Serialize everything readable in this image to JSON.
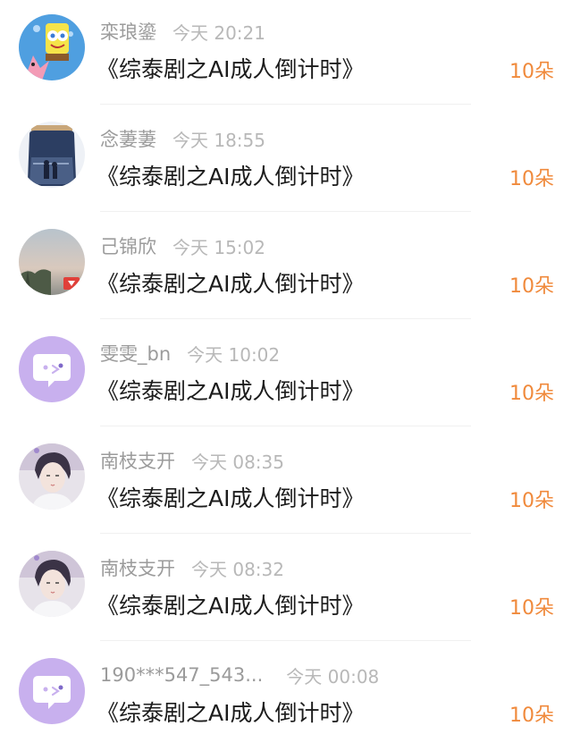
{
  "colors": {
    "accent_amount": "#f08a3c",
    "username": "#9b9b9b",
    "time": "#b8b8b8",
    "title": "#1c1c1c",
    "default_avatar_bg": "#c8b0ee"
  },
  "rows": [
    {
      "avatar": "spongebob-avatar-icon",
      "username": "栾琅鎏",
      "time": "今天 20:21",
      "title": "《综泰剧之AI成人倒计时》",
      "amount": "10朵"
    },
    {
      "avatar": "jar-photo-avatar-icon",
      "username": "念萋萋",
      "time": "今天 18:55",
      "title": "《综泰剧之AI成人倒计时》",
      "amount": "10朵"
    },
    {
      "avatar": "sky-photo-avatar-icon",
      "username": "己锦欣",
      "time": "今天 15:02",
      "title": "《综泰剧之AI成人倒计时》",
      "amount": "10朵"
    },
    {
      "avatar": "default-chat-avatar-icon",
      "username": "雯雯_bn",
      "time": "今天 10:02",
      "title": "《综泰剧之AI成人倒计时》",
      "amount": "10朵"
    },
    {
      "avatar": "portrait-avatar-icon",
      "username": "南枝支开",
      "time": "今天 08:35",
      "title": "《综泰剧之AI成人倒计时》",
      "amount": "10朵"
    },
    {
      "avatar": "portrait-avatar-icon",
      "username": "南枝支开",
      "time": "今天 08:32",
      "title": "《综泰剧之AI成人倒计时》",
      "amount": "10朵"
    },
    {
      "avatar": "default-chat-avatar-icon",
      "username": "190***547_543...",
      "time": "今天 00:08",
      "title": "《综泰剧之AI成人倒计时》",
      "amount": "10朵"
    }
  ]
}
